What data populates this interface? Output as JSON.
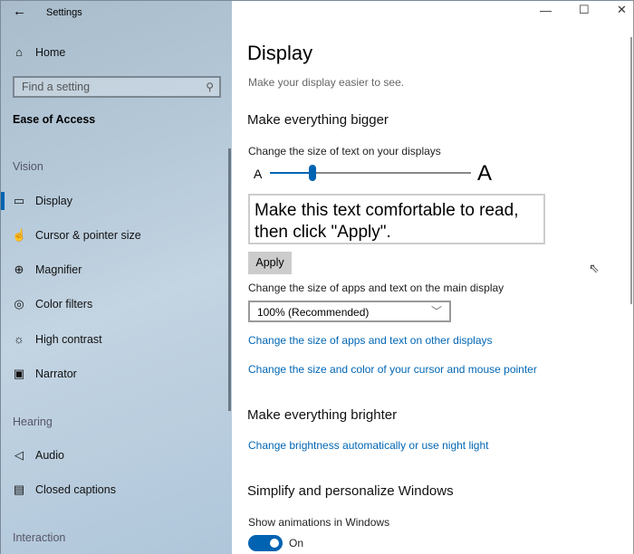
{
  "window": {
    "title": "Settings"
  },
  "sidebar": {
    "home": "Home",
    "search_placeholder": "Find a setting",
    "category": "Ease of Access",
    "sections": {
      "vision": "Vision",
      "hearing": "Hearing",
      "interaction": "Interaction"
    },
    "items": [
      {
        "label": "Display",
        "icon": "monitor-icon"
      },
      {
        "label": "Cursor & pointer size",
        "icon": "pointer-icon"
      },
      {
        "label": "Magnifier",
        "icon": "magnifier-icon"
      },
      {
        "label": "Color filters",
        "icon": "color-filter-icon"
      },
      {
        "label": "High contrast",
        "icon": "sun-icon"
      },
      {
        "label": "Narrator",
        "icon": "narrator-icon"
      },
      {
        "label": "Audio",
        "icon": "speaker-icon"
      },
      {
        "label": "Closed captions",
        "icon": "cc-icon"
      }
    ]
  },
  "main": {
    "title": "Display",
    "subtitle": "Make your display easier to see.",
    "bigger": {
      "heading": "Make everything bigger",
      "text_size_label": "Change the size of text on your displays",
      "small_a": "A",
      "large_a": "A",
      "slider_percent": 21,
      "preview": "Make this text comfortable to read, then click \"Apply\".",
      "apply": "Apply",
      "scale_label": "Change the size of apps and text on the main display",
      "scale_value": "100% (Recommended)",
      "link_other": "Change the size of apps and text on other displays",
      "link_cursor": "Change the size and color of your cursor and mouse pointer"
    },
    "brighter": {
      "heading": "Make everything brighter",
      "link": "Change brightness automatically or use night light"
    },
    "simplify": {
      "heading": "Simplify and personalize Windows",
      "anim_label": "Show animations in Windows",
      "anim_state": "On"
    }
  }
}
